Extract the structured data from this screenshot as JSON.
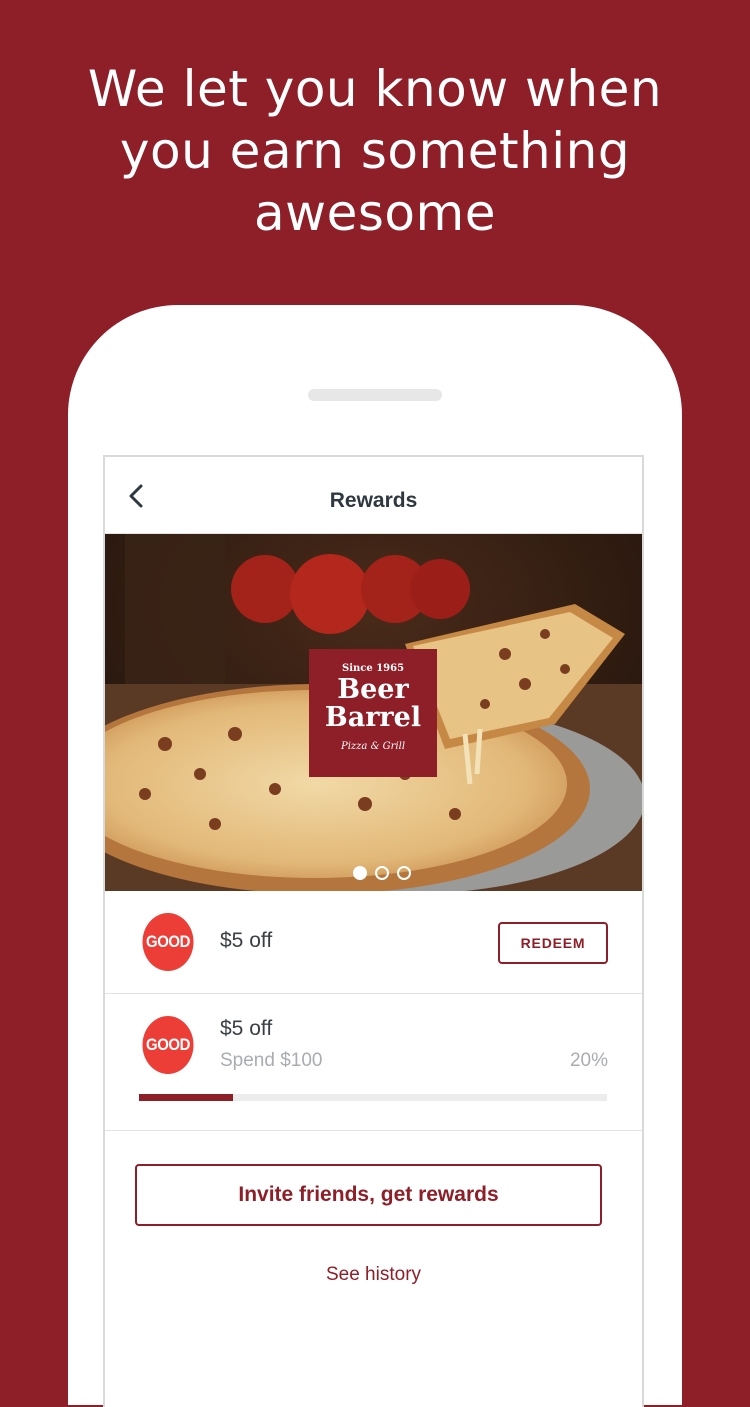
{
  "headline": {
    "lines": [
      "We let you know when",
      "you earn something",
      "awesome"
    ]
  },
  "nav": {
    "title": "Rewards",
    "back_icon": "chevron-left-icon"
  },
  "hero": {
    "logo": {
      "since": "Since 1965",
      "word1": "Beer",
      "word2": "Barrel",
      "tagline": "Pizza & Grill"
    },
    "carousel": {
      "total": 3,
      "active": 1
    }
  },
  "rewards": [
    {
      "badge": "GOOD",
      "title": "$5 off",
      "action_label": "REDEEM"
    },
    {
      "badge": "GOOD",
      "title": "$5 off",
      "requirement": "Spend $100",
      "progress_label": "20%",
      "progress": 0.2
    }
  ],
  "actions": {
    "invite_label": "Invite friends, get rewards",
    "history_label": "See history"
  },
  "colors": {
    "brand": "#8e1e27",
    "badge": "#ec3e37",
    "muted_text": "#a9acb0"
  }
}
